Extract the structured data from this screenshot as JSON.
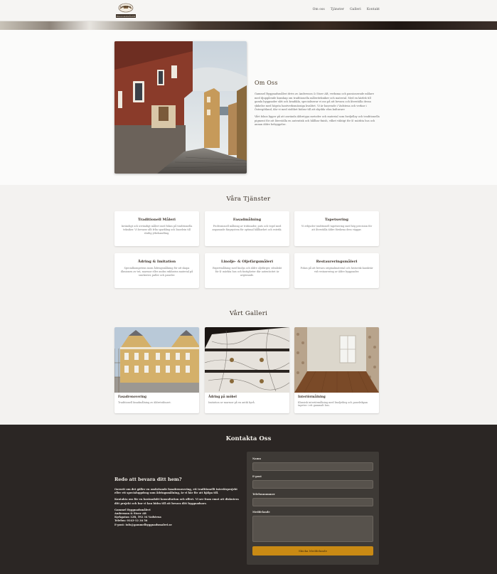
{
  "header": {
    "logo_text_top": "GAMMEL",
    "logo_text_bottom": "BYGGNADSMÅLERI",
    "nav": [
      "Om oss",
      "Tjänster",
      "Galleri",
      "Kontakt"
    ]
  },
  "about": {
    "title": "Om Oss",
    "paragraph1": "Gammel Byggnadsmåleri drivs av Andersson & Stoer AB, verksma och passionerade målare med djupgående kunskap om traditionella måleritekniker och material. Med en kärlek till gamla byggnader sått och kvadikla, specialiserar vi oss på att bevara och återställa dessa skikelse med högsta hantverksmässiga kvalitet. Vi är baserade i Vadstena och verkar i Östergötland, där vi med stolthet bidrar till att skydda våra kulturarv.",
    "paragraph2": "Vårt fokus ligger på att använda äldretypa metoder och material som fordjellay och traditionella pigment för att återställa en autentisk och hållbar finish, vilket väktigt för K- märkta hus och annan äldre bebyggelse."
  },
  "services": {
    "title": "Våra Tjänster",
    "items": [
      {
        "title": "Traditionell Måleri",
        "desc": "Invändigt och utvändigt målert med fokus på traditionella tekniker. Vi bevarar allt från sparkling och linoelein till slutlig ytbehandling."
      },
      {
        "title": "Fasadmålning",
        "desc": "Professionell målning av träfasader, puts och tegel med anpassade färgsystem för optimal hållbarhet och estetik."
      },
      {
        "title": "Tapetsering",
        "desc": "Vi erbjuder traditionell tapetsering med hög precision för att återställa äldre förskrna dess väggar."
      },
      {
        "title": "Ådring & Imitation",
        "desc": "Specialkompetens inom ådringsmålning för att skapa illusionen av trä, marmor eller andra exklusiva material på snickerier, paller och paneler."
      },
      {
        "title": "Linolje- & Oljefärgsmåleri",
        "desc": "Expertmålning med linolja och äldre oljefärger, idealiskt för K- märkta hus och fastigheter där autenticitet är avgörande."
      },
      {
        "title": "Restaureringsmåleri",
        "desc": "Fokus på att bevara originalmaterial och historisk karaktär vid restaurering av äldre byggnader."
      }
    ]
  },
  "gallery": {
    "title": "Vårt Galleri",
    "items": [
      {
        "title": "Fasadrenovering",
        "desc": "Traditionell fasadmålning av äldreträhuset."
      },
      {
        "title": "Ådring på möbel",
        "desc": "Imitation av marmor på en antik byrå."
      },
      {
        "title": "Interiörmålning",
        "desc": "Klassisk interiörmålning med linoljefärg och panelrikpan tapeter i ett gammalt hus."
      }
    ]
  },
  "contact": {
    "title": "Kontakta Oss",
    "heading": "Redo att bevara ditt hem?",
    "paragraph1": "Oavsett om det gäller en omfattande fasadrenovering, ett traditionellt interiörprojekt eller ett specialuppdrag som ådringsmålning, är vi här för att hjälpa till.",
    "paragraph2": "Kontakta oss för en kostnadsfri konsultation och offert. Vi ser fram emot att diskutera ditt projekt och hur vi kan bidra till att bevara ditt byggnadsarv.",
    "address_lines": [
      "Gammel Byggnadsmåleri",
      "Andersson & Stoer AB",
      "Kyrkgatan 12B, 592 34 Vadstena",
      "Telefon: 0143-12 34 56",
      "E-post: info@gammelbyggnadsmaleri.se"
    ],
    "form": {
      "name_label": "Namn",
      "email_label": "E-post",
      "phone_label": "Telefonnummer",
      "message_label": "Meddelande",
      "submit_label": "Skicka Meddelande"
    }
  }
}
